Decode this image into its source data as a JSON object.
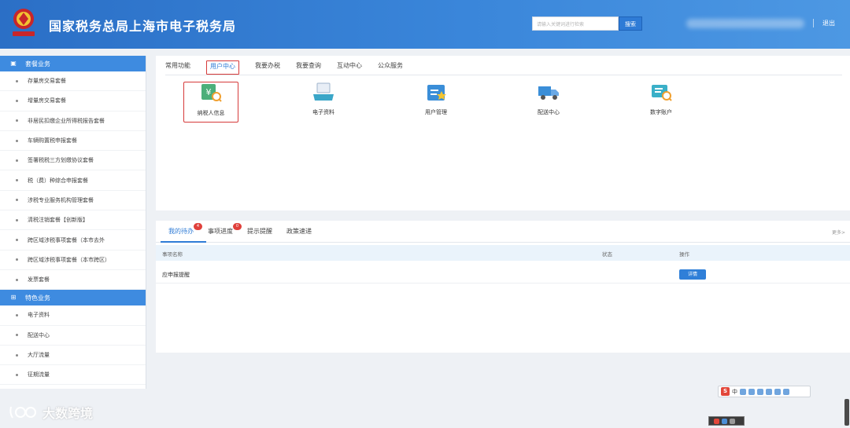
{
  "header": {
    "title": "国家税务总局上海市电子税务局",
    "search_placeholder": "请输入关键词进行检索",
    "search_button": "搜索",
    "logout": "退出"
  },
  "sidebar": {
    "section1": "套餐业务",
    "items1": [
      "存量房交易套餐",
      "增量房交易套餐",
      "非居民扣缴企业所得税报告套餐",
      "车辆购置税申报套餐",
      "签署税税三方划缴协议套餐",
      "税（费）种综合申报套餐",
      "涉税专业服务机构管理套餐",
      "清税注销套餐【创新版】",
      "跨区域涉税事项套餐（本市去外",
      "跨区域涉税事项套餐（本市跨区）",
      "发票套餐"
    ],
    "section2": "特色业务",
    "items2": [
      "电子资料",
      "配送中心",
      "大厅流量",
      "征期流量"
    ]
  },
  "main": {
    "tabs": [
      "常用功能",
      "用户中心",
      "我要办税",
      "我要查询",
      "互动中心",
      "公众服务"
    ],
    "active_tab": 1,
    "functions": [
      "纳税人信息",
      "电子资料",
      "用户管理",
      "配送中心",
      "数字账户"
    ]
  },
  "bottom": {
    "tabs": [
      "我的待办",
      "事项进度",
      "提示提醒",
      "政策速递"
    ],
    "badges": [
      "4",
      "0"
    ],
    "more": "更多>",
    "columns": [
      "事项名称",
      "状态",
      "操作"
    ],
    "rows": [
      {
        "name": "应申报提醒",
        "status": "",
        "action": "详情"
      }
    ]
  },
  "ime": {
    "logo": "S",
    "lang": "中"
  },
  "watermark": "大数跨境",
  "colors": {
    "header": "#3a86da",
    "accent": "#2e7bd6",
    "highlight": "#d63a3a"
  }
}
